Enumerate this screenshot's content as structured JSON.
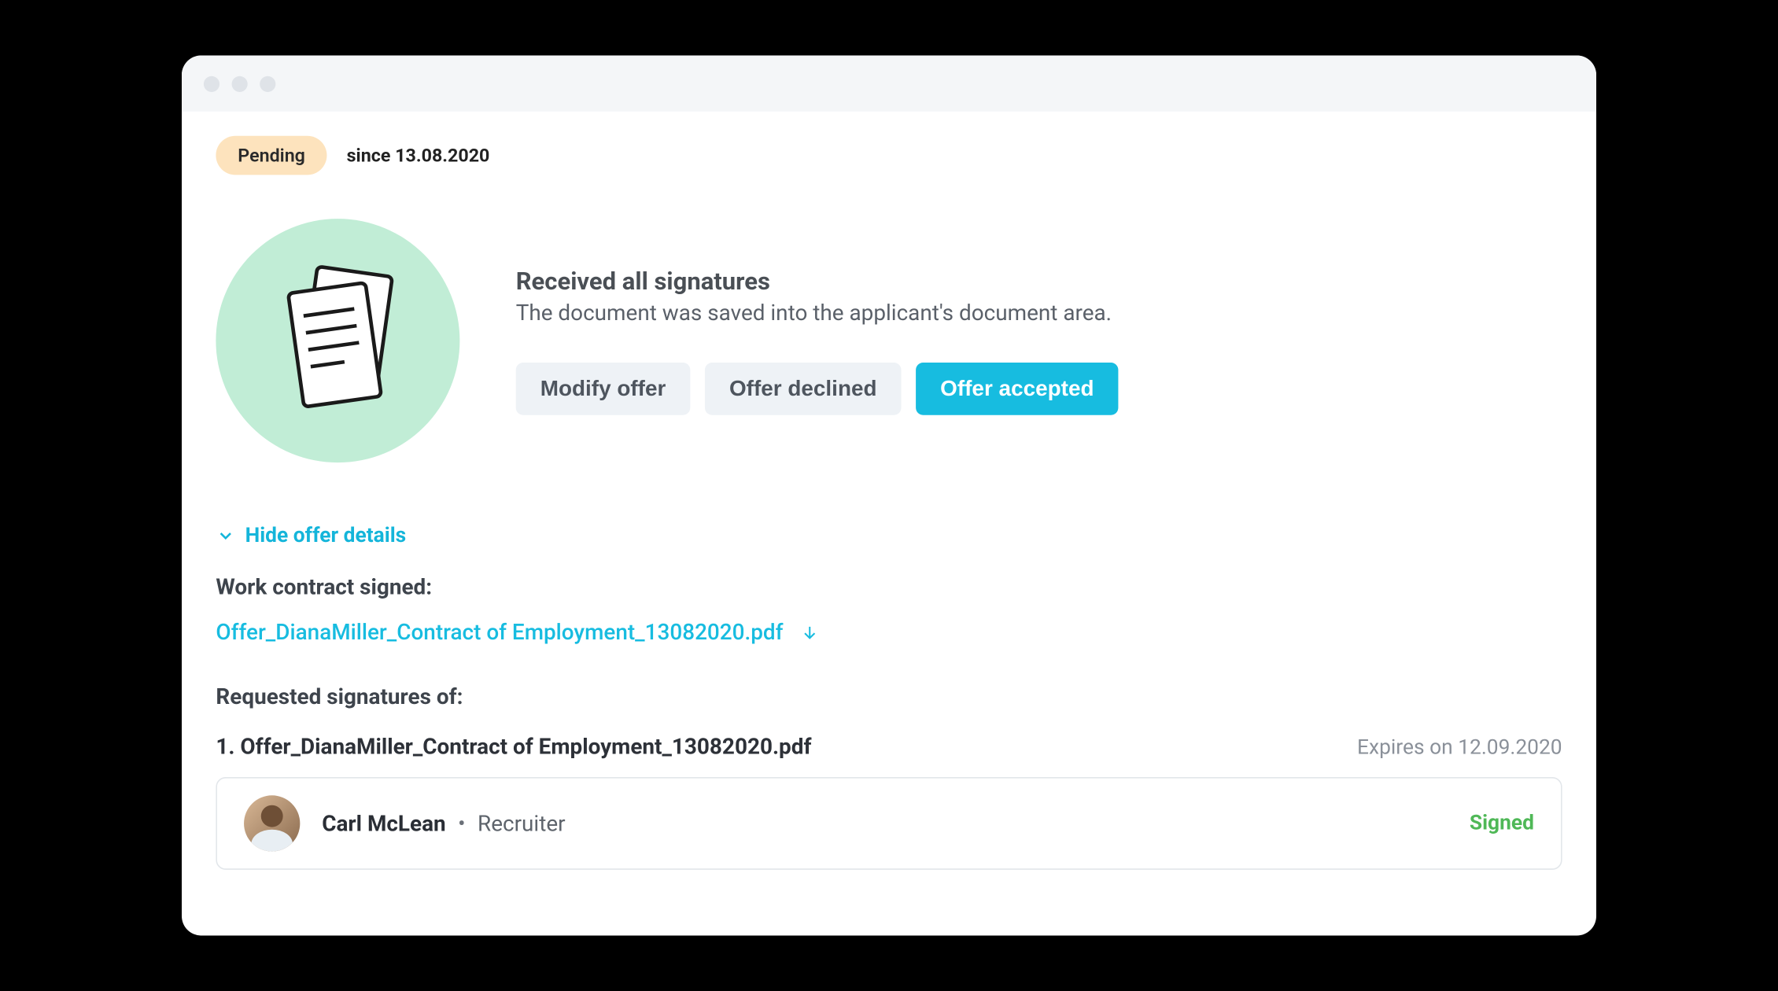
{
  "status": {
    "badge": "Pending",
    "since_label": "since 13.08.2020"
  },
  "hero": {
    "title": "Received all signatures",
    "subtitle": "The document was saved into the applicant's document area.",
    "actions": {
      "modify": "Modify offer",
      "declined": "Offer declined",
      "accepted": "Offer accepted"
    }
  },
  "toggle_label": "Hide offer details",
  "contract_section_label": "Work contract signed:",
  "contract_file": "Offer_DianaMiller_Contract of Employment_13082020.pdf",
  "signatures_section_label": "Requested signatures of:",
  "signature_doc": {
    "index_label": "1. Offer_DianaMiller_Contract of Employment_13082020.pdf",
    "expires": "Expires on 12.09.2020"
  },
  "signer": {
    "name": "Carl McLean",
    "separator": "•",
    "role": "Recruiter",
    "status": "Signed"
  }
}
